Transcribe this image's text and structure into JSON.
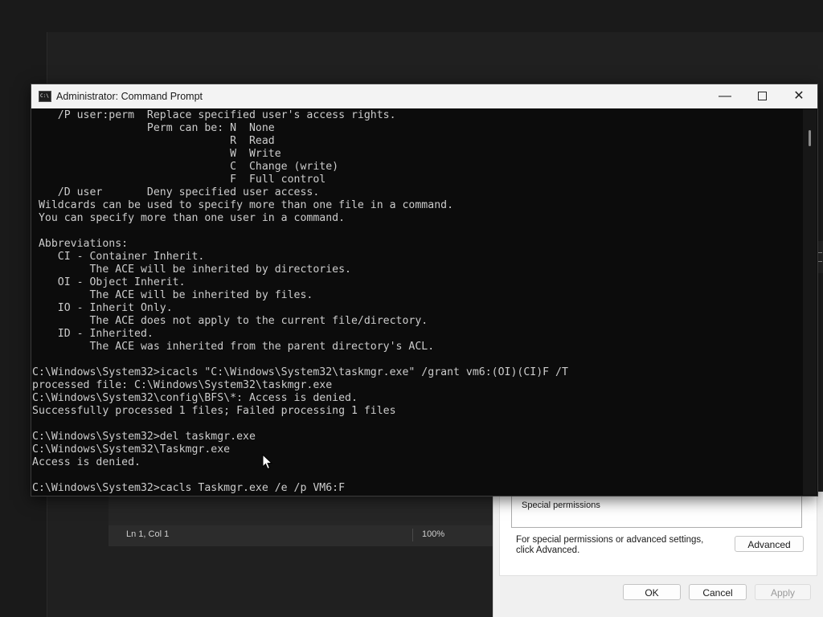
{
  "cmd": {
    "title": "Administrator: Command Prompt",
    "icon_text": "C:\\",
    "controls": {
      "minimize": "—",
      "close": "✕"
    },
    "lines": [
      "    /P user:perm  Replace specified user's access rights.",
      "                  Perm can be: N  None",
      "                               R  Read",
      "                               W  Write",
      "                               C  Change (write)",
      "                               F  Full control",
      "    /D user       Deny specified user access.",
      " Wildcards can be used to specify more than one file in a command.",
      " You can specify more than one user in a command.",
      "",
      " Abbreviations:",
      "    CI - Container Inherit.",
      "         The ACE will be inherited by directories.",
      "    OI - Object Inherit.",
      "         The ACE will be inherited by files.",
      "    IO - Inherit Only.",
      "         The ACE does not apply to the current file/directory.",
      "    ID - Inherited.",
      "         The ACE was inherited from the parent directory's ACL.",
      "",
      "C:\\Windows\\System32>icacls \"C:\\Windows\\System32\\taskmgr.exe\" /grant vm6:(OI)(CI)F /T",
      "processed file: C:\\Windows\\System32\\taskmgr.exe",
      "C:\\Windows\\System32\\config\\BFS\\*: Access is denied.",
      "Successfully processed 1 files; Failed processing 1 files",
      "",
      "C:\\Windows\\System32>del taskmgr.exe",
      "C:\\Windows\\System32\\Taskmgr.exe",
      "Access is denied.",
      "",
      "C:\\Windows\\System32>cacls Taskmgr.exe /e /p VM6:F"
    ]
  },
  "notepad_status": {
    "position": "Ln 1, Col 1",
    "zoom": "100%"
  },
  "properties_dialog": {
    "permissions_row": "Special permissions",
    "advanced_text": "For special permissions or advanced settings, click Advanced.",
    "advanced_button": "Advanced",
    "ok_button": "OK",
    "cancel_button": "Cancel",
    "apply_button": "Apply"
  }
}
